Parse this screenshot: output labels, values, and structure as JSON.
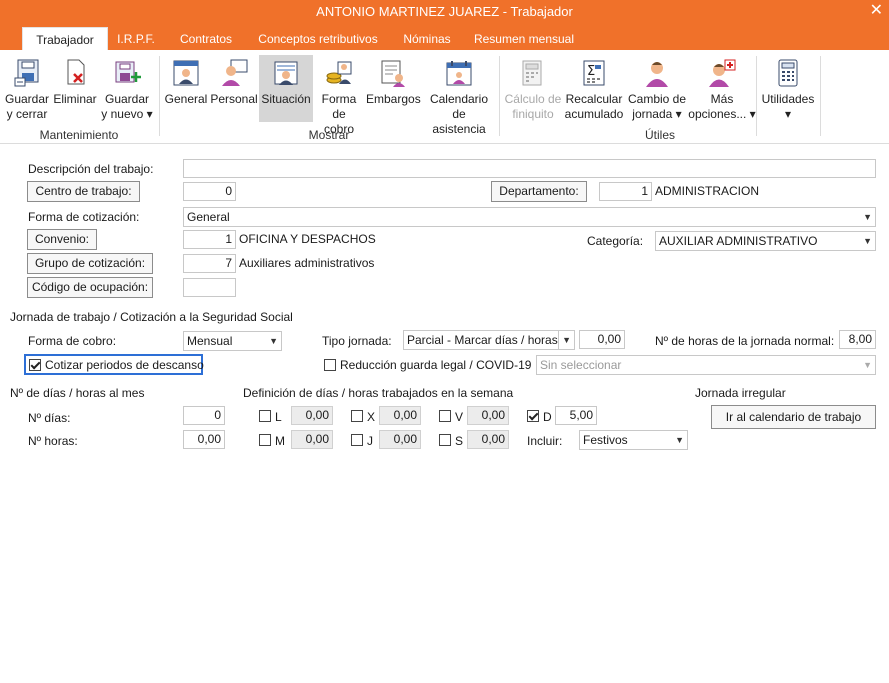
{
  "window": {
    "title": "ANTONIO MARTINEZ JUAREZ - Trabajador",
    "close_glyph": "✕"
  },
  "tabs": [
    "Trabajador",
    "I.R.P.F.",
    "Contratos",
    "Conceptos retributivos",
    "Nóminas",
    "Resumen mensual"
  ],
  "ribbon": {
    "buttons": [
      {
        "l1": "Guardar",
        "l2": "y cerrar",
        "icon": "save-close-icon"
      },
      {
        "l1": "Eliminar",
        "l2": "",
        "icon": "delete-icon"
      },
      {
        "l1": "Guardar",
        "l2": "y nuevo ▾",
        "icon": "save-new-icon"
      },
      {
        "l1": "General",
        "l2": "",
        "icon": "person-card-icon"
      },
      {
        "l1": "Personal",
        "l2": "",
        "icon": "person-icon"
      },
      {
        "l1": "Situación",
        "l2": "",
        "icon": "situation-icon"
      },
      {
        "l1": "Forma",
        "l2": "de cobro",
        "icon": "coins-icon"
      },
      {
        "l1": "Embargos",
        "l2": "",
        "icon": "seizure-icon"
      },
      {
        "l1": "Calendario",
        "l2": "de asistencia",
        "icon": "calendar-icon"
      },
      {
        "l1": "Cálculo de",
        "l2": "finiquito",
        "icon": "settlement-icon"
      },
      {
        "l1": "Recalcular",
        "l2": "acumulado",
        "icon": "sigma-icon"
      },
      {
        "l1": "Cambio de",
        "l2": "jornada ▾",
        "icon": "shift-change-icon"
      },
      {
        "l1": "Más",
        "l2": "opciones... ▾",
        "icon": "more-options-icon"
      },
      {
        "l1": "Utilidades",
        "l2": "▾",
        "icon": "calculator-icon"
      }
    ],
    "groups": [
      "Mantenimiento",
      "Mostrar",
      "Útiles"
    ]
  },
  "form": {
    "descripcion_label": "Descripción del trabajo:",
    "descripcion_value": "",
    "centro_btn": "Centro de trabajo:",
    "centro_value": "0",
    "departamento_btn": "Departamento:",
    "departamento_value": "1",
    "departamento_name": "ADMINISTRACION",
    "forma_cot_label": "Forma de cotización:",
    "forma_cot_value": "General",
    "convenio_btn": "Convenio:",
    "convenio_value": "1",
    "convenio_name": "OFICINA Y DESPACHOS",
    "categoria_label": "Categoría:",
    "categoria_value": "AUXILIAR ADMINISTRATIVO",
    "grupo_btn": "Grupo de cotización:",
    "grupo_value": "7",
    "grupo_name": "Auxiliares administrativos",
    "codigo_btn": "Código de ocupación:",
    "codigo_value": ""
  },
  "jornada": {
    "section": "Jornada de trabajo / Cotización a la Seguridad Social",
    "forma_cobro_label": "Forma de cobro:",
    "forma_cobro_value": "Mensual",
    "tipo_label": "Tipo jornada:",
    "tipo_value": "Parcial - Marcar días / horas",
    "tipo_num": "0,00",
    "horas_normal_label": "Nº de horas de la jornada normal:",
    "horas_normal_value": "8,00",
    "cotizar_label": "Cotizar periodos de descanso",
    "cotizar_checked": true,
    "reduccion_label": "Reducción guarda legal / COVID-19",
    "reduccion_checked": false,
    "reduccion_select": "Sin seleccionar"
  },
  "dias": {
    "section": "Nº de días / horas al mes",
    "dias_label": "Nº días:",
    "dias_value": "0",
    "horas_label": "Nº horas:",
    "horas_value": "0,00"
  },
  "semana": {
    "section": "Definición de días / horas trabajados en la semana",
    "days": [
      {
        "letter": "L",
        "value": "0,00",
        "checked": false
      },
      {
        "letter": "M",
        "value": "0,00",
        "checked": false
      },
      {
        "letter": "X",
        "value": "0,00",
        "checked": false
      },
      {
        "letter": "J",
        "value": "0,00",
        "checked": false
      },
      {
        "letter": "V",
        "value": "0,00",
        "checked": false
      },
      {
        "letter": "S",
        "value": "0,00",
        "checked": false
      },
      {
        "letter": "D",
        "value": "5,00",
        "checked": true
      }
    ],
    "incluir_label": "Incluir:",
    "incluir_value": "Festivos"
  },
  "irregular": {
    "section": "Jornada irregular",
    "button": "Ir al calendario de trabajo"
  },
  "colors": {
    "accent": "#f0712a",
    "focus": "#2d6fd6"
  }
}
